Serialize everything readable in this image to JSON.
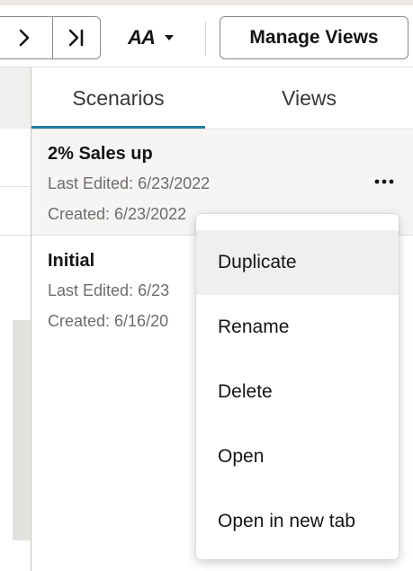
{
  "toolbar": {
    "next_icon": "chevron-right-icon",
    "last_icon": "chevron-right-bar-icon",
    "font_label": "AA",
    "font_icon": "font-size-icon",
    "font_dropdown_icon": "caret-down-icon",
    "manage_views_label": "Manage Views"
  },
  "tabs": [
    {
      "label": "Scenarios",
      "selected": true
    },
    {
      "label": "Views",
      "selected": false
    }
  ],
  "scenarios": [
    {
      "title": "2% Sales up",
      "last_edited": "Last Edited: 6/23/2022",
      "created": "Created: 6/23/2022",
      "more_icon": "more-horizontal-icon"
    },
    {
      "title": "Initial",
      "last_edited": "Last Edited: 6/23",
      "created": "Created: 6/16/20"
    }
  ],
  "context_menu": {
    "items": [
      {
        "label": "Duplicate",
        "highlighted": true
      },
      {
        "label": "Rename"
      },
      {
        "label": "Delete"
      },
      {
        "label": "Open"
      },
      {
        "label": "Open in new tab"
      }
    ]
  },
  "colors": {
    "accent_underline": "#227e9e",
    "text_primary": "#161513",
    "text_secondary": "#6f6c69",
    "selected_row_bg": "#f6f5f3",
    "menu_highlight_bg": "#f1efed"
  }
}
